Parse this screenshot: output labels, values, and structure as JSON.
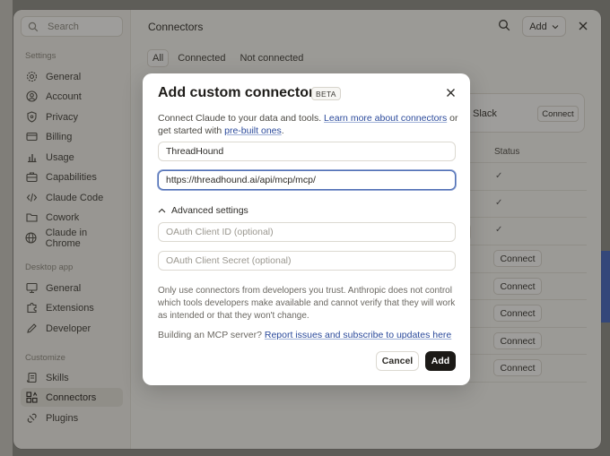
{
  "sidebar": {
    "search_placeholder": "Search",
    "sections": [
      {
        "title": "Settings",
        "items": [
          {
            "label": "General",
            "icon": "gear-icon"
          },
          {
            "label": "Account",
            "icon": "user-icon"
          },
          {
            "label": "Privacy",
            "icon": "shield-icon"
          },
          {
            "label": "Billing",
            "icon": "card-icon"
          },
          {
            "label": "Usage",
            "icon": "chart-icon"
          },
          {
            "label": "Capabilities",
            "icon": "briefcase-icon"
          },
          {
            "label": "Claude Code",
            "icon": "code-icon"
          },
          {
            "label": "Cowork",
            "icon": "folder-icon"
          },
          {
            "label": "Claude in Chrome",
            "icon": "globe-icon"
          }
        ]
      },
      {
        "title": "Desktop app",
        "items": [
          {
            "label": "General",
            "icon": "monitor-icon"
          },
          {
            "label": "Extensions",
            "icon": "puzzle-icon"
          },
          {
            "label": "Developer",
            "icon": "pencil-icon"
          }
        ]
      },
      {
        "title": "Customize",
        "items": [
          {
            "label": "Skills",
            "icon": "scroll-icon"
          },
          {
            "label": "Connectors",
            "icon": "connector-icon",
            "active": true
          },
          {
            "label": "Plugins",
            "icon": "plug-icon"
          }
        ]
      }
    ]
  },
  "main": {
    "title": "Connectors",
    "add_label": "Add",
    "tabs": [
      {
        "label": "All",
        "active": true
      },
      {
        "label": "Connected"
      },
      {
        "label": "Not connected"
      }
    ],
    "card": {
      "name": "Slack",
      "button": "Connect"
    },
    "status_header": "Status",
    "checks": [
      "✓",
      "✓",
      "✓"
    ],
    "row_buttons": [
      "Connect",
      "Connect",
      "Connect",
      "Connect",
      "Connect"
    ]
  },
  "modal": {
    "title": "Add custom connector",
    "badge": "BETA",
    "desc_prefix": "Connect Claude to your data and tools. ",
    "desc_link1": "Learn more about connectors",
    "desc_mid": " or get started with ",
    "desc_link2": "pre-built ones",
    "desc_suffix": ".",
    "name_value": "ThreadHound",
    "url_value": "https://threadhound.ai/api/mcp/mcp/",
    "advanced_label": "Advanced settings",
    "client_id_placeholder": "OAuth Client ID (optional)",
    "client_secret_placeholder": "OAuth Client Secret (optional)",
    "warning": "Only use connectors from developers you trust. Anthropic does not control which tools developers make available and cannot verify that they will work as intended or that they won't change.",
    "build_prefix": "Building an MCP server? ",
    "build_link": "Report issues and subscribe to updates here",
    "cancel_label": "Cancel",
    "add_label": "Add"
  }
}
